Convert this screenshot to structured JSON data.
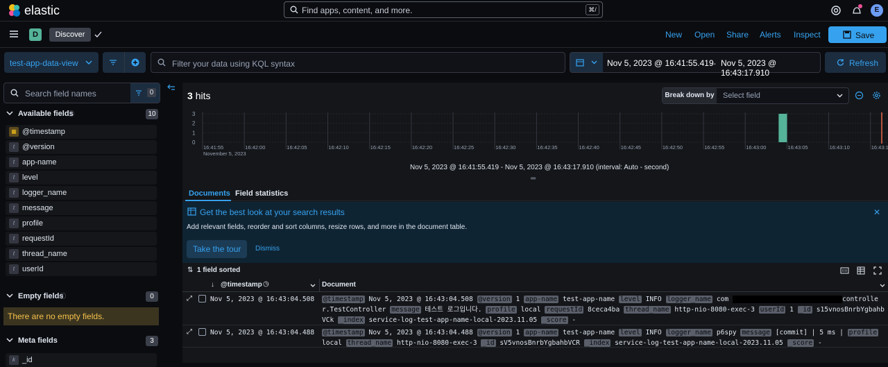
{
  "header": {
    "brand": "elastic",
    "search_placeholder": "Find apps, content, and more.",
    "search_shortcut": "⌘/",
    "avatar": "E"
  },
  "nav": {
    "space": "D",
    "breadcrumb": "Discover",
    "links": [
      "New",
      "Open",
      "Share",
      "Alerts",
      "Inspect"
    ],
    "save_label": "Save"
  },
  "query": {
    "data_view": "test-app-data-view",
    "kql_placeholder": "Filter your data using KQL syntax",
    "start": "Nov 5, 2023 @ 16:41:55.419",
    "end": "Nov 5, 2023 @ 16:43:17.910",
    "refresh_label": "Refresh"
  },
  "sidebar": {
    "search_placeholder": "Search field names",
    "filter_count": "0",
    "available_label": "Available fields",
    "available_count": "10",
    "fields": [
      {
        "type": "▦",
        "name": "@timestamp"
      },
      {
        "type": "t",
        "name": "@version"
      },
      {
        "type": "t",
        "name": "app-name"
      },
      {
        "type": "t",
        "name": "level"
      },
      {
        "type": "t",
        "name": "logger_name"
      },
      {
        "type": "t",
        "name": "message"
      },
      {
        "type": "t",
        "name": "profile"
      },
      {
        "type": "t",
        "name": "requestId"
      },
      {
        "type": "t",
        "name": "thread_name"
      },
      {
        "type": "t",
        "name": "userId"
      }
    ],
    "empty_label": "Empty fields",
    "empty_count": "0",
    "empty_note": "There are no empty fields.",
    "meta_label": "Meta fields",
    "meta_count": "3",
    "meta_first": {
      "type": "k",
      "name": "_id"
    }
  },
  "histogram": {
    "hits_count": "3",
    "hits_label": "hits",
    "breakdown_label": "Break down by",
    "breakdown_placeholder": "Select field",
    "range_caption": "Nov 5, 2023 @ 16:41:55.419 - Nov 5, 2023 @ 16:43:17.910 (interval: Auto - second)"
  },
  "chart_data": {
    "type": "bar",
    "x_ticks": [
      "16:41:55",
      "16:42:00",
      "16:42:05",
      "16:42:10",
      "16:42:15",
      "16:42:20",
      "16:42:25",
      "16:42:30",
      "16:42:35",
      "16:42:40",
      "16:42:45",
      "16:42:50",
      "16:42:55",
      "16:43:00",
      "16:43:05",
      "16:43:10",
      "16:43:15"
    ],
    "x_subtitle": "November 5, 2023",
    "y_ticks": [
      "3",
      "2",
      "1",
      "0"
    ],
    "ylim": [
      0,
      3
    ],
    "bars": [
      {
        "x": "16:43:04",
        "value": 3
      }
    ],
    "bar_color": "#54b399",
    "now_marker_color": "#e7664c"
  },
  "tabs": [
    "Documents",
    "Field statistics"
  ],
  "callout": {
    "title": "Get the best look at your search results",
    "body": "Add relevant fields, reorder and sort columns, resize rows, and more in the document table.",
    "tour": "Take the tour",
    "dismiss": "Dismiss"
  },
  "table": {
    "sorted_label": "1 field sorted",
    "col_timestamp": "@timestamp",
    "col_document": "Document",
    "rows": [
      {
        "timestamp": "Nov 5, 2023 @ 16:43:04.508",
        "doc": [
          [
            "@timestamp",
            "Nov 5, 2023 @ 16:43:04.508"
          ],
          [
            "@version",
            "1"
          ],
          [
            "app-name",
            "test-app-name"
          ],
          [
            "level",
            "INFO"
          ],
          [
            "logger_name",
            "com"
          ],
          [
            "",
            "controller.TestController"
          ],
          [
            "message",
            "테스트 로그입니다."
          ],
          [
            "profile",
            "local"
          ],
          [
            "requestId",
            "8ceca4ba"
          ],
          [
            "thread_name",
            "http-nio-8080-exec-3"
          ],
          [
            "userId",
            "1"
          ],
          [
            "_id",
            "s15vnosBnrbYgbahbVCk"
          ],
          [
            "_index",
            "service-log-test-app-name-local-2023.11.05"
          ],
          [
            "_score",
            "-"
          ]
        ]
      },
      {
        "timestamp": "Nov 5, 2023 @ 16:43:04.488",
        "doc": [
          [
            "@timestamp",
            "Nov 5, 2023 @ 16:43:04.488"
          ],
          [
            "@version",
            "1"
          ],
          [
            "app-name",
            "test-app-name"
          ],
          [
            "level",
            "INFO"
          ],
          [
            "logger_name",
            "p6spy"
          ],
          [
            "message",
            "[commit] | 5 ms |"
          ],
          [
            "profile",
            "local"
          ],
          [
            "thread_name",
            "http-nio-8080-exec-3"
          ],
          [
            "_id",
            "sV5vnosBnrbYgbahbVCR"
          ],
          [
            "_index",
            "service-log-test-app-name-local-2023.11.05"
          ],
          [
            "_score",
            "-"
          ]
        ]
      }
    ]
  }
}
